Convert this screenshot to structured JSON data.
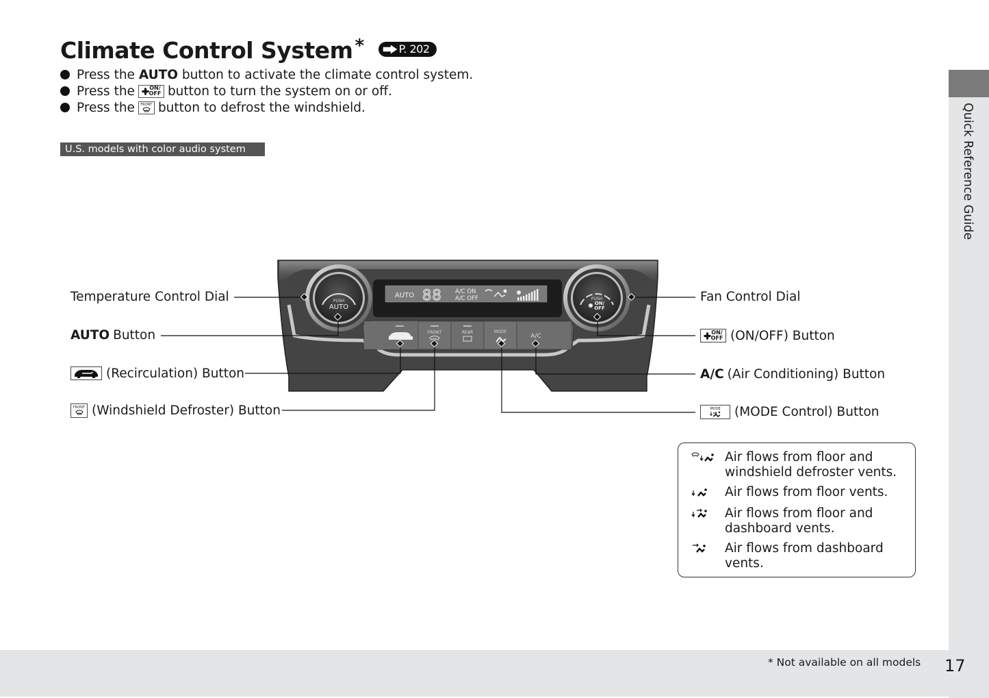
{
  "header": {
    "title": "Climate Control System",
    "title_marker": "*",
    "reference": "P. 202"
  },
  "bullets": [
    {
      "prefix": "Press the",
      "bold": "AUTO",
      "icon": null,
      "suffix": "button to activate the climate control system."
    },
    {
      "prefix": "Press the",
      "bold": null,
      "icon": "fan-on-off-icon",
      "suffix": "button to turn the system on or off."
    },
    {
      "prefix": "Press the",
      "bold": null,
      "icon": "front-defrost-icon",
      "suffix": "button to defrost the windshield."
    }
  ],
  "icons": {
    "onoff_top": "ON/",
    "onoff_bottom": "OFF",
    "front": "FRONT",
    "mode": "MODE"
  },
  "model_tag": "U.S. models with color audio system",
  "side_tab": "Quick Reference Guide",
  "panel": {
    "left_dial_push": "PUSH",
    "left_dial_label": "AUTO",
    "right_dial_push": "PUSH",
    "right_dial_on": "ON/",
    "right_dial_off": "OFF",
    "display_auto": "AUTO",
    "display_temp": "88",
    "display_ac_on": "A/C  ON",
    "display_ac_off": "A/C OFF",
    "btn_front": "FRONT",
    "btn_rear": "REAR",
    "btn_mode": "MODE",
    "btn_ac": "A/C"
  },
  "callouts_left": [
    {
      "bold": "",
      "icon": null,
      "text": "Temperature Control Dial"
    },
    {
      "bold": "AUTO",
      "icon": null,
      "text": "Button"
    },
    {
      "bold": "",
      "icon": "recirculation-icon",
      "text": "(Recirculation) Button"
    },
    {
      "bold": "",
      "icon": "front-defrost-icon",
      "text": "(Windshield Defroster) Button"
    }
  ],
  "callouts_right": [
    {
      "bold": "",
      "icon": null,
      "text": "Fan Control Dial"
    },
    {
      "bold": "",
      "icon": "fan-on-off-icon",
      "text": "(ON/OFF) Button"
    },
    {
      "bold": "A/C",
      "icon": null,
      "text": "(Air Conditioning) Button"
    },
    {
      "bold": "",
      "icon": "mode-icon",
      "text": "(MODE Control) Button"
    }
  ],
  "legend": [
    {
      "icon": "floor-defrost-airflow-icon",
      "text": "Air flows from floor and windshield defroster vents."
    },
    {
      "icon": "floor-airflow-icon",
      "text": "Air flows from floor vents."
    },
    {
      "icon": "floor-dashboard-airflow-icon",
      "text": "Air flows from floor and dashboard vents."
    },
    {
      "icon": "dashboard-airflow-icon",
      "text": "Air flows from dashboard vents."
    }
  ],
  "footer": {
    "footnote": "* Not available on all models",
    "page_number": "17"
  }
}
